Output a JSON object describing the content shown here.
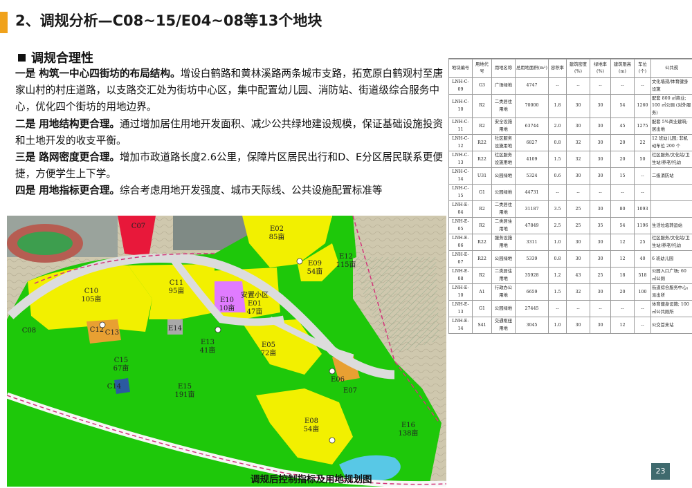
{
  "header": {
    "title": "2、调规分析—C08~15/E04~08等13个地块",
    "accent_color": "#f0a21c"
  },
  "section": {
    "heading": "调规合理性",
    "points": [
      {
        "lead": "一是 构筑一中心四街坊的布局结构。",
        "text": "增设白鹤路和黄林溪路两条城市支路，拓宽原白鹤观村至唐家山村的村庄道路，以支路交汇处为街坊中心区，集中配置幼儿园、消防站、街道级综合服务中心，优化四个街坊的用地边界。"
      },
      {
        "lead": "二是 用地结构更合理。",
        "text": "通过增加居住用地开发面积、减少公共绿地建设规模，保证基础设施投资和土地开发的收支平衡。"
      },
      {
        "lead": "三是 路网密度更合理。",
        "text": "增加市政道路长度2.6公里，保障片区居民出行和D、E分区居民联系更便捷，方便学生上下学。"
      },
      {
        "lead": "四是 用地指标更合理。",
        "text": "综合考虑用地开发强度、城市天际线、公共设施配置标准等"
      }
    ]
  },
  "map": {
    "caption": "调规后控制指标及用地规划图",
    "colors": {
      "residential": "#f2f000",
      "green": "#1ec80a",
      "public": "#e07bff",
      "facility": "#e8a032",
      "road": "#d9d9d9",
      "terrain": "#c9c2a8"
    },
    "labels": [
      {
        "code": "C08",
        "area": ""
      },
      {
        "code": "C10",
        "area": "105亩"
      },
      {
        "code": "C11",
        "area": "95亩"
      },
      {
        "code": "C12",
        "area": ""
      },
      {
        "code": "C13",
        "area": ""
      },
      {
        "code": "C14",
        "area": ""
      },
      {
        "code": "C15",
        "area": "67亩"
      },
      {
        "code": "E01",
        "area": "47亩"
      },
      {
        "code": "E02",
        "area": "85亩"
      },
      {
        "code": "E05",
        "area": "72亩"
      },
      {
        "code": "E06",
        "area": ""
      },
      {
        "code": "E07",
        "area": ""
      },
      {
        "code": "E08",
        "area": "54亩"
      },
      {
        "code": "E09",
        "area": "54亩"
      },
      {
        "code": "E10",
        "area": "10亩"
      },
      {
        "code": "E12",
        "area": "115亩"
      },
      {
        "code": "E13",
        "area": "41亩"
      },
      {
        "code": "E14",
        "area": ""
      },
      {
        "code": "E15",
        "area": "191亩"
      },
      {
        "code": "E16",
        "area": "138亩"
      },
      {
        "code": "C07",
        "area": ""
      }
    ],
    "residential_name": "安置小区"
  },
  "table": {
    "headers": [
      "地块编号",
      "用地代号",
      "用地名称",
      "总用地面积(m²)",
      "容积率",
      "建筑密度(%)",
      "绿地率(%)",
      "建筑限高(m)",
      "车位(个)",
      "公共规"
    ],
    "rows": [
      [
        "LNH-C-09",
        "G3",
        "广场绿地",
        "4747",
        "--",
        "--",
        "--",
        "--",
        "--",
        "文化墙规/体育健身设施"
      ],
      [
        "LNH-C-10",
        "R2",
        "二类居住用地",
        "70000",
        "1.8",
        "30",
        "30",
        "54",
        "1260",
        "配套 800 ㎡商业; 100 ㎡公厕 (对外服务)"
      ],
      [
        "LNH-C-11",
        "R2",
        "安全设施用地",
        "63744",
        "2.0",
        "30",
        "30",
        "45",
        "1275",
        "配套 5%商业建筑; 居出地"
      ],
      [
        "LNH-C-12",
        "R22",
        "社区服务设施用地",
        "6827",
        "0.8",
        "32",
        "30",
        "20",
        "22",
        "12 班幼儿园; 非机动车位 200 个"
      ],
      [
        "LNH-C-13",
        "R22",
        "社区服务设施用地",
        "4109",
        "1.5",
        "32",
        "30",
        "20",
        "50",
        "社区服务/文化站/卫生站/养老/托幼"
      ],
      [
        "LNH-C-14",
        "U31",
        "公园绿地",
        "5324",
        "0.6",
        "30",
        "30",
        "15",
        "--",
        "二级消防站"
      ],
      [
        "LNH-C-15",
        "G1",
        "公园绿地",
        "44731",
        "--",
        "--",
        "--",
        "--",
        "--",
        ""
      ],
      [
        "LNH-E-04",
        "R2",
        "二类居住用地",
        "31187",
        "3.5",
        "25",
        "30",
        "80",
        "1093",
        ""
      ],
      [
        "LNH-E-05",
        "R2",
        "二类居住用地",
        "47849",
        "2.5",
        "25",
        "35",
        "54",
        "1196",
        "生活垃圾转运站"
      ],
      [
        "LNH-E-06",
        "R22",
        "服务设施用地",
        "3311",
        "1.0",
        "30",
        "30",
        "12",
        "25",
        "社区服务/文化站/卫生站/养老/托幼"
      ],
      [
        "LNH-E-07",
        "R22",
        "公园绿地",
        "5339",
        "0.8",
        "30",
        "30",
        "12",
        "40",
        "6 班幼儿园"
      ],
      [
        "LNH-E-08",
        "R2",
        "二类居住用地",
        "35928",
        "1.2",
        "43",
        "25",
        "18",
        "518",
        "公园入口广场; 60 ㎡公厕"
      ],
      [
        "LNH-E-10",
        "A1",
        "行政办公用地",
        "6659",
        "1.5",
        "32",
        "30",
        "20",
        "100",
        "街道综合服务中心; 派出所"
      ],
      [
        "LNH-E-13",
        "G1",
        "公园绿地",
        "27445",
        "--",
        "--",
        "--",
        "--",
        "--",
        "体育健身设施; 100 ㎡公共厕所"
      ],
      [
        "LNH-E-14",
        "S41",
        "交通枢纽用地",
        "3045",
        "1.0",
        "30",
        "30",
        "12",
        "--",
        "公交首末站"
      ]
    ]
  },
  "page": {
    "number": "23"
  }
}
